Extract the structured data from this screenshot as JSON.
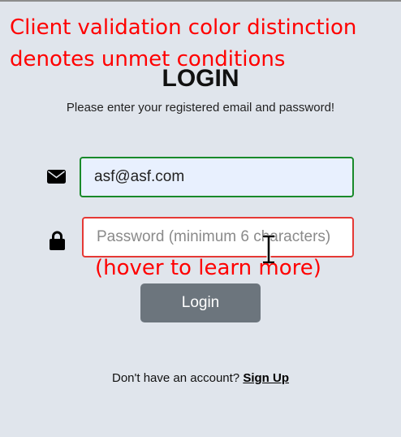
{
  "annotation": {
    "line1": "Client validation color distinction",
    "line2": "denotes unmet conditions",
    "hover_note": "(hover to learn more)"
  },
  "login": {
    "title": "LOGIN",
    "subtitle": "Please enter your registered email and password!",
    "email_value": "asf@asf.com",
    "email_icon": "envelope-icon",
    "password_placeholder": "Password (minimum 6 characters)",
    "password_icon": "lock-icon",
    "button_label": "Login",
    "signup_prompt": "Don't have an account?",
    "signup_link": "Sign Up"
  },
  "colors": {
    "valid_border": "#198a2a",
    "invalid_border": "#e53935",
    "annotation": "#ff0000",
    "button": "#6c757d",
    "background": "#e0e5ec"
  }
}
